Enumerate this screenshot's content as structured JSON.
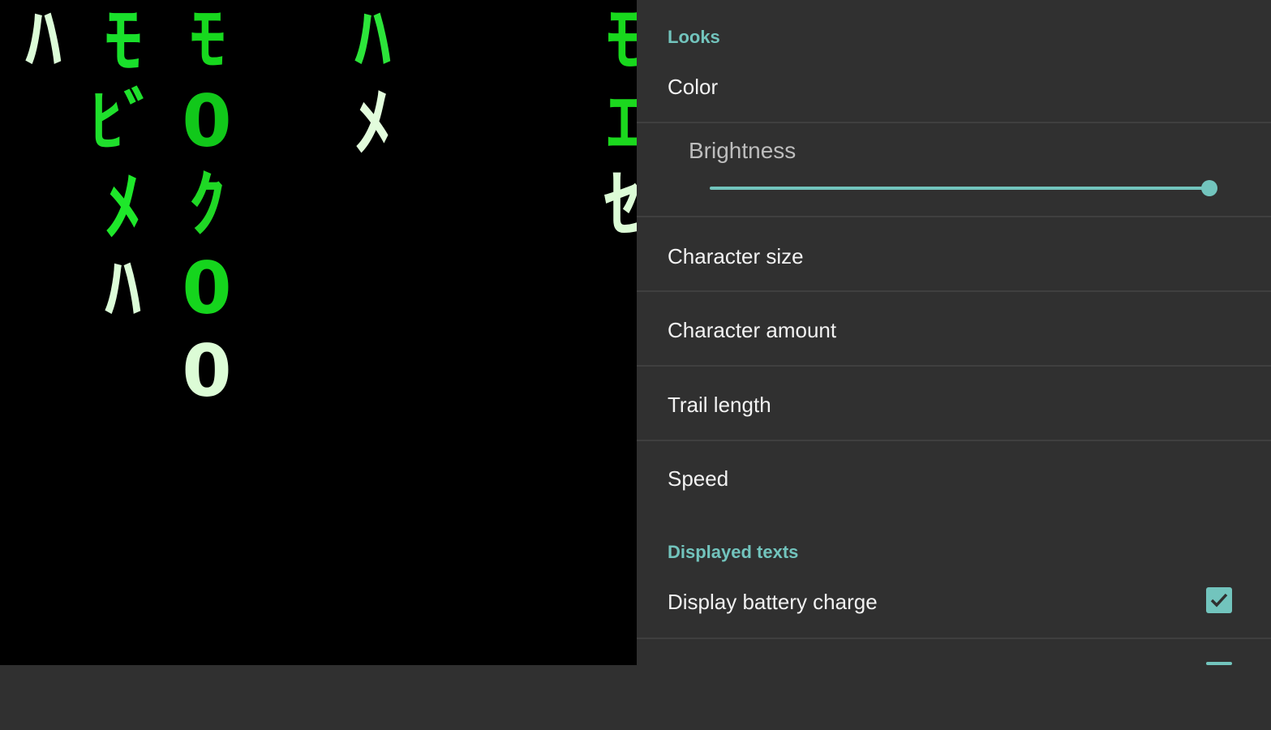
{
  "preview": {
    "glyphs": [
      {
        "char": "ﾊ",
        "color": "#dcfcd8"
      },
      {
        "char": "ﾓ",
        "color": "#19e02b"
      },
      {
        "char": "ﾓ",
        "color": "#17d81e"
      },
      {
        "char": "ﾊ",
        "color": "#2ce53a"
      },
      {
        "char": "ﾓ",
        "color": "#18d81d"
      },
      {
        "char": "ﾋﾞ",
        "color": "#1fe02c"
      },
      {
        "char": "0",
        "color": "#11c81a"
      },
      {
        "char": "ﾒ",
        "color": "#e2fcdc"
      },
      {
        "char": "ｴ",
        "color": "#1bd81e"
      },
      {
        "char": "ﾒ",
        "color": "#1ee82a"
      },
      {
        "char": "ｸ",
        "color": "#1fd825"
      },
      {
        "char": "ｾ",
        "color": "#dcfcd6"
      },
      {
        "char": "ﾊ",
        "color": "#dcfcd8"
      },
      {
        "char": "0",
        "color": "#15d51d"
      },
      {
        "char": "0",
        "color": "#dcfcd6"
      }
    ]
  },
  "settings": {
    "looks_header": "Looks",
    "color_label": "Color",
    "brightness": {
      "label": "Brightness",
      "value": 1.0
    },
    "character_size_label": "Character size",
    "character_amount_label": "Character amount",
    "trail_length_label": "Trail length",
    "speed_label": "Speed",
    "displayed_texts_header": "Displayed texts",
    "display_battery_charge": {
      "label": "Display battery charge",
      "checked": true
    }
  },
  "colors": {
    "accent": "#72c4bd",
    "background": "#303030",
    "preview_background": "#000000"
  }
}
